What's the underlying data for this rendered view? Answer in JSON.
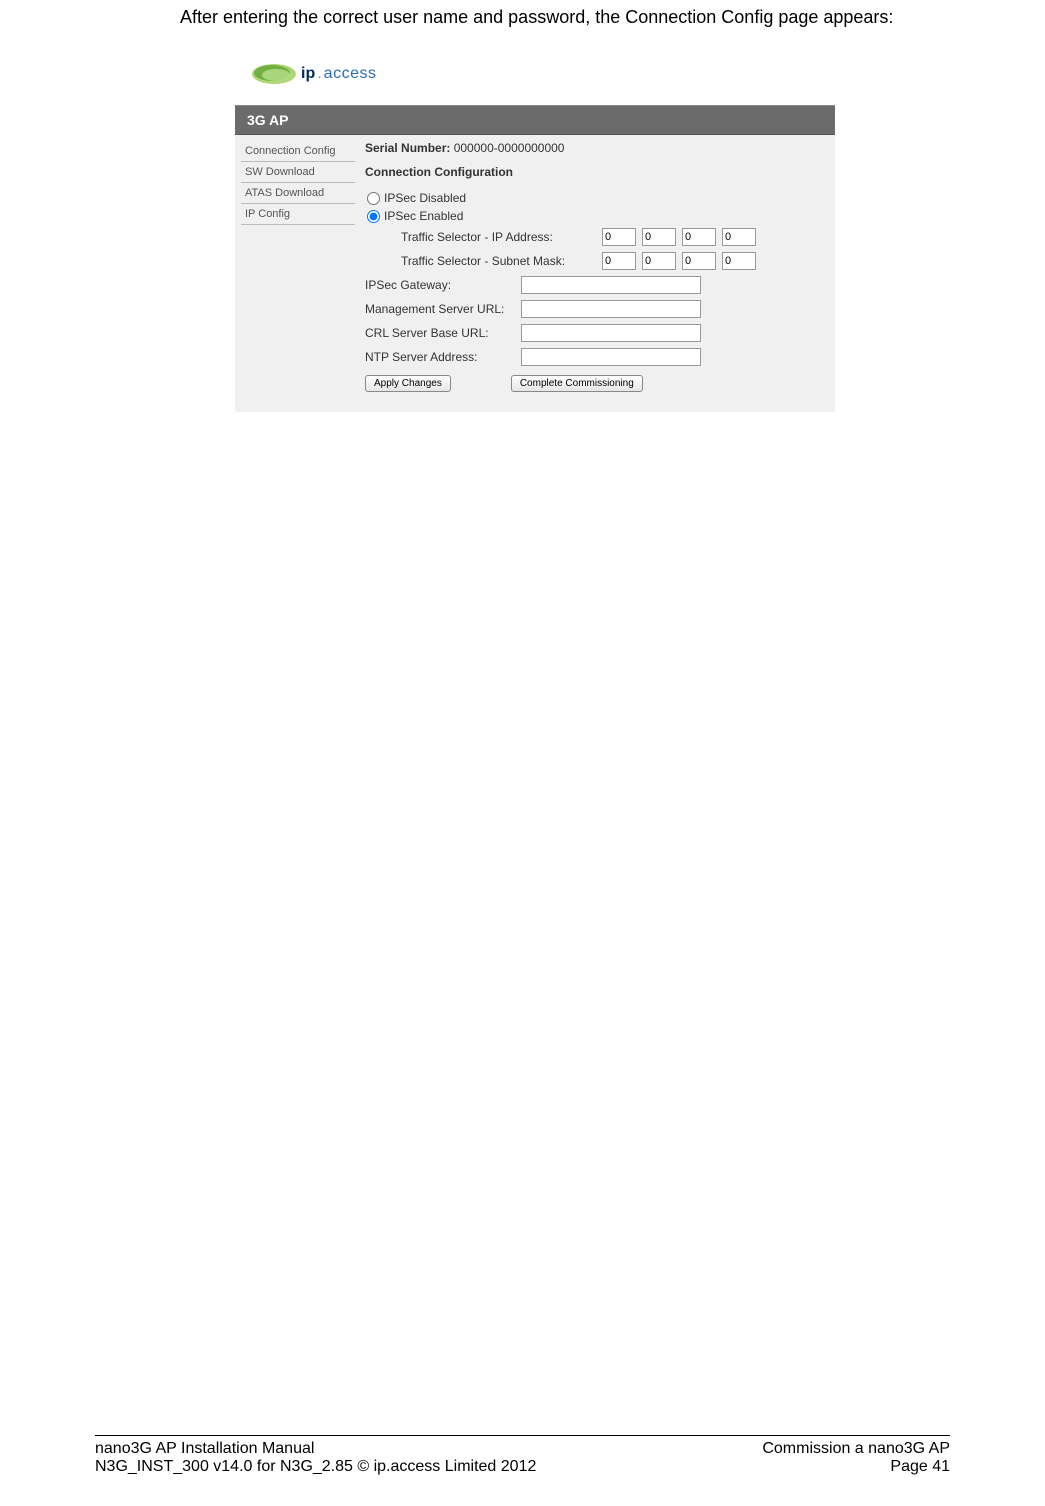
{
  "intro": "After entering the correct user name and password, the Connection Config page appears:",
  "logo": {
    "ip": "ip",
    "dot": ".",
    "access": "access"
  },
  "titlebar": "3G AP",
  "sidebar": {
    "items": [
      {
        "label": "Connection Config"
      },
      {
        "label": "SW Download"
      },
      {
        "label": "ATAS Download"
      },
      {
        "label": "IP Config"
      }
    ]
  },
  "main": {
    "serial_label": "Serial Number:",
    "serial_value": "000000-0000000000",
    "heading": "Connection Configuration",
    "radio_disabled": "IPSec Disabled",
    "radio_enabled": "IPSec Enabled",
    "ts_ip_label": "Traffic Selector - IP Address:",
    "ts_ip": [
      "0",
      "0",
      "0",
      "0"
    ],
    "ts_mask_label": "Traffic Selector - Subnet Mask:",
    "ts_mask": [
      "0",
      "0",
      "0",
      "0"
    ],
    "ipsec_gw_label": "IPSec Gateway:",
    "ipsec_gw": "",
    "mgmt_url_label": "Management Server URL:",
    "mgmt_url": "",
    "crl_url_label": "CRL Server Base URL:",
    "crl_url": "",
    "ntp_label": "NTP Server Address:",
    "ntp": "",
    "apply_label": "Apply Changes",
    "complete_label": "Complete Commissioning"
  },
  "footer": {
    "left1": "nano3G AP Installation Manual",
    "left2": "N3G_INST_300 v14.0 for N3G_2.85 © ip.access Limited 2012",
    "right1": "Commission a nano3G AP",
    "right2": "Page 41"
  }
}
